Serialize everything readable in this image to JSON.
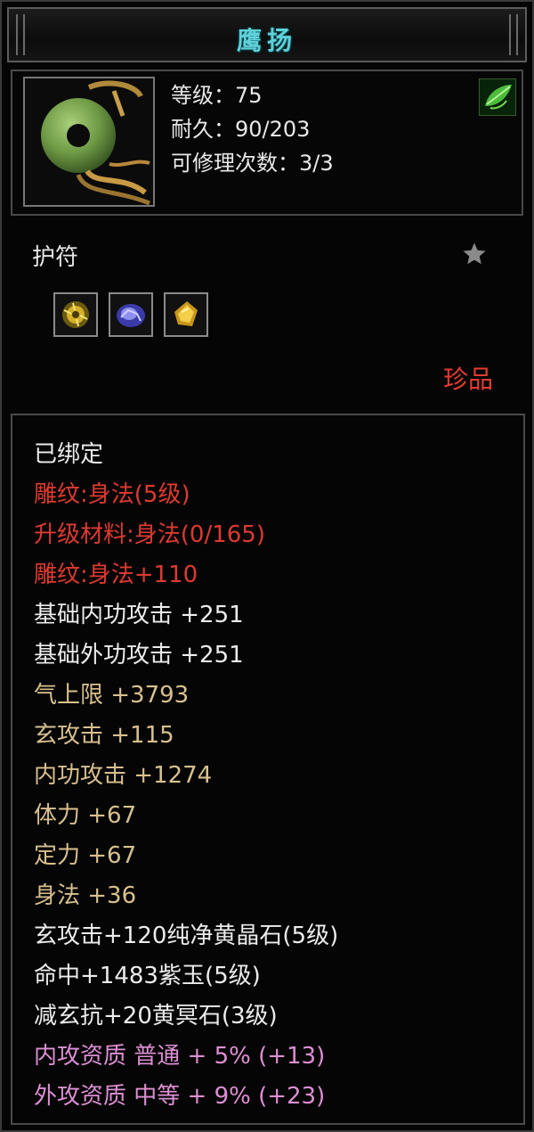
{
  "item": {
    "name": "鹰扬",
    "level_label": "等级：75",
    "durability_label": "耐久：90/203",
    "repair_label": "可修理次数：3/3",
    "type": "护符",
    "quality": "珍品"
  },
  "icons": {
    "item": "jade-pendant-icon",
    "corner": "green-leaf-icon",
    "star": "star-icon",
    "gems": [
      "yellow-gem-icon",
      "purple-gem-icon",
      "gold-gem-icon"
    ]
  },
  "colors": {
    "title": "#5fd0d8",
    "white": "#ececec",
    "red": "#dd3a30",
    "tan": "#d8c08e",
    "pink": "#dd8fd3",
    "quality": "#e43c31"
  },
  "attributes": [
    {
      "text": "已绑定",
      "color": "white"
    },
    {
      "text": "雕纹:身法(5级)",
      "color": "red"
    },
    {
      "text": "升级材料:身法(0/165)",
      "color": "red"
    },
    {
      "text": "雕纹:身法+110",
      "color": "red"
    },
    {
      "text": "基础内功攻击 +251",
      "color": "white"
    },
    {
      "text": "基础外功攻击 +251",
      "color": "white"
    },
    {
      "text": "气上限 +3793",
      "color": "tan"
    },
    {
      "text": "玄攻击 +115",
      "color": "tan"
    },
    {
      "text": "内功攻击 +1274",
      "color": "tan"
    },
    {
      "text": "体力 +67",
      "color": "tan"
    },
    {
      "text": "定力 +67",
      "color": "tan"
    },
    {
      "text": "身法 +36",
      "color": "tan"
    },
    {
      "text": "玄攻击+120纯净黄晶石(5级)",
      "color": "white"
    },
    {
      "text": "命中+1483紫玉(5级)",
      "color": "white"
    },
    {
      "text": "减玄抗+20黄冥石(3级)",
      "color": "white"
    },
    {
      "text": "内攻资质 普通 + 5% (+13)",
      "color": "pink"
    },
    {
      "text": "外攻资质 中等 + 9% (+23)",
      "color": "pink"
    }
  ]
}
